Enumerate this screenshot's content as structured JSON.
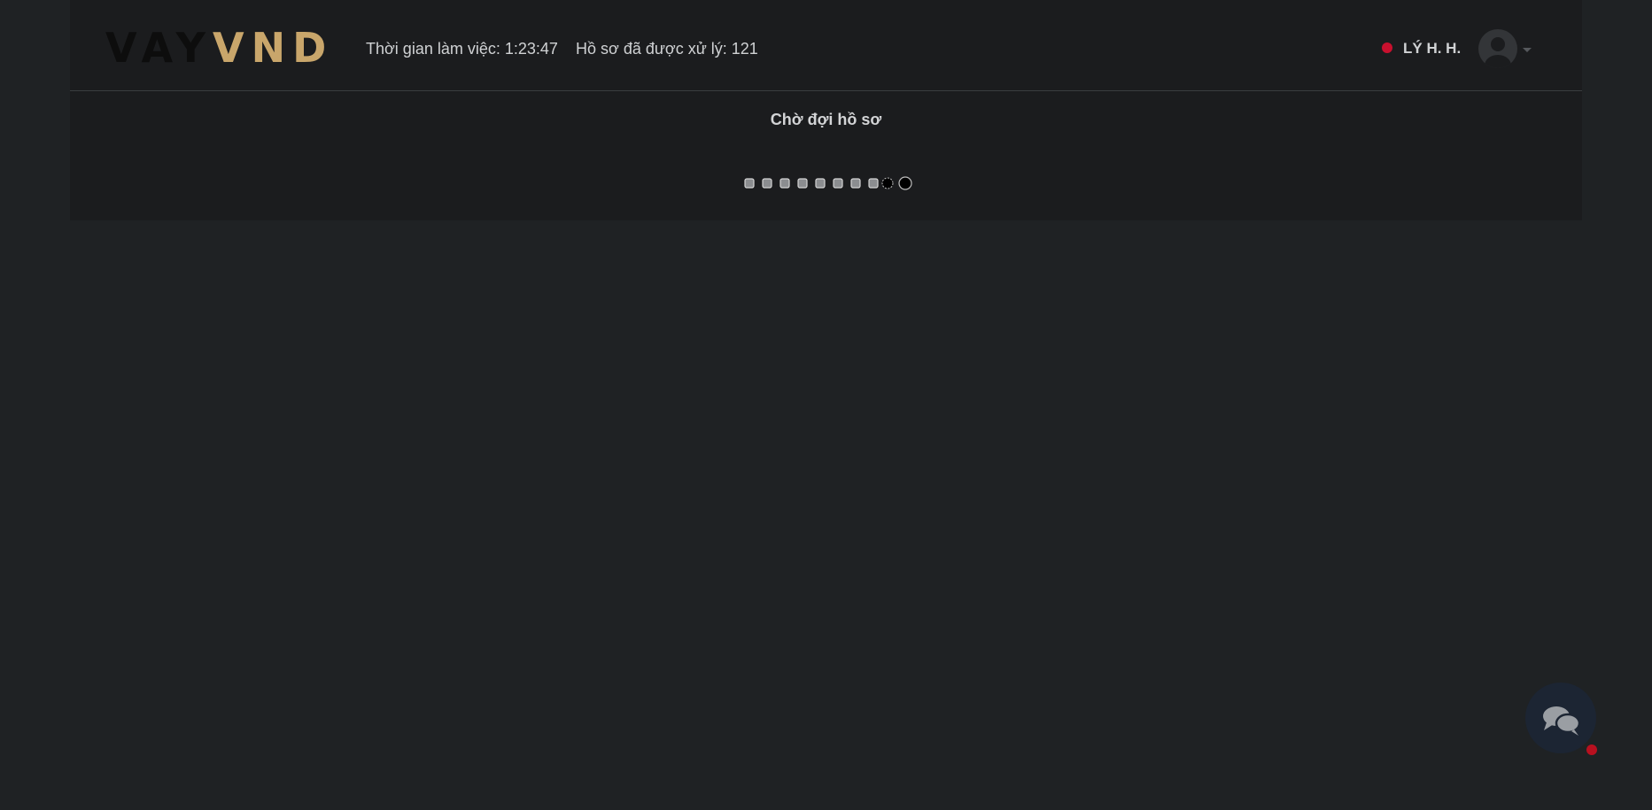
{
  "header": {
    "logo_left": "VAY",
    "logo_right": "VND",
    "work_time": "Thời gian làm việc: 1:23:47",
    "processed_count": "Hồ sơ đã được xử lý: 121",
    "user_name": "LÝ H. H."
  },
  "main": {
    "status_title": "Chờ đợi hồ sơ"
  },
  "colors": {
    "page_background": "#1f2224",
    "panel_background": "#1b1c1e",
    "brand_gold": "#c9a66b",
    "status_red": "#c8102e",
    "text_light": "#d0d2d4"
  },
  "icons": {
    "status": "online-status-dot",
    "avatar": "user-avatar-icon",
    "menu": "caret-down-icon",
    "chat": "chat-bubbles-icon",
    "loader": "loading-dots"
  }
}
